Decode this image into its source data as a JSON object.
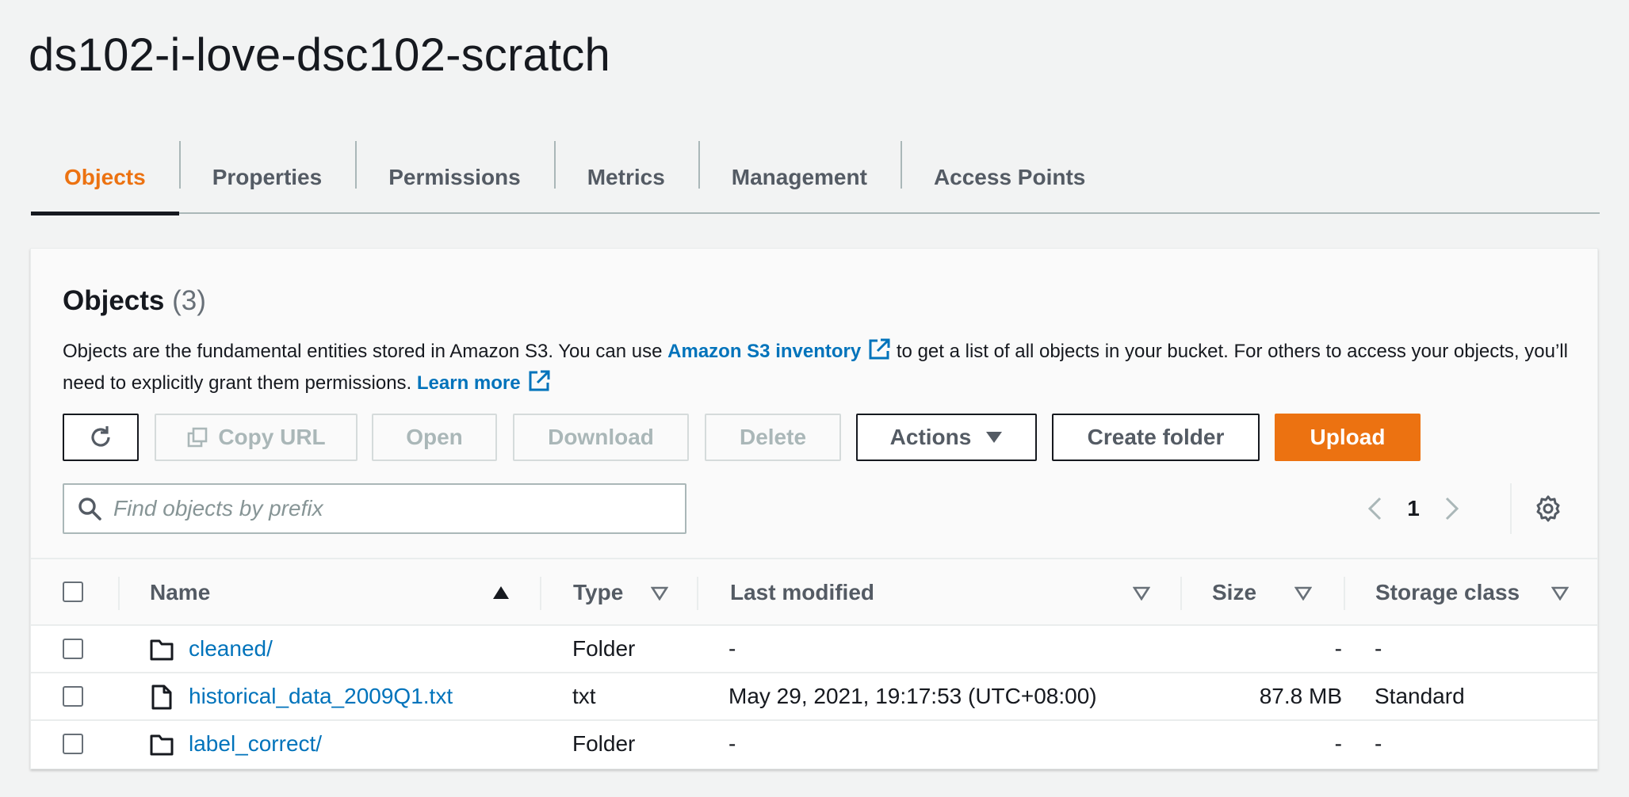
{
  "page": {
    "title": "ds102-i-love-dsc102-scratch"
  },
  "tabs": [
    {
      "label": "Objects",
      "active": true
    },
    {
      "label": "Properties",
      "active": false
    },
    {
      "label": "Permissions",
      "active": false
    },
    {
      "label": "Metrics",
      "active": false
    },
    {
      "label": "Management",
      "active": false
    },
    {
      "label": "Access Points",
      "active": false
    }
  ],
  "objects_panel": {
    "title": "Objects",
    "count": "(3)",
    "desc_part1": "Objects are the fundamental entities stored in Amazon S3. You can use ",
    "inventory_link": "Amazon S3 inventory",
    "desc_part2": " to get a list of all objects in your bucket. For others to access your objects, you’ll need to explicitly grant them permissions. ",
    "learn_more": "Learn more"
  },
  "toolbar": {
    "refresh_icon": "refresh-icon",
    "copy_url": "Copy URL",
    "open": "Open",
    "download": "Download",
    "delete": "Delete",
    "actions": "Actions",
    "create_folder": "Create folder",
    "upload": "Upload"
  },
  "search": {
    "placeholder": "Find objects by prefix",
    "value": ""
  },
  "pagination": {
    "current_page": "1"
  },
  "colors": {
    "accent": "#ec7211",
    "link": "#0073bb",
    "text": "#16191f"
  },
  "table": {
    "columns": {
      "name": "Name",
      "type": "Type",
      "last_modified": "Last modified",
      "size": "Size",
      "storage_class": "Storage class"
    },
    "rows": [
      {
        "icon": "folder-icon",
        "name": "cleaned/",
        "type": "Folder",
        "last_modified": "-",
        "size": "-",
        "storage_class": "-"
      },
      {
        "icon": "file-icon",
        "name": "historical_data_2009Q1.txt",
        "type": "txt",
        "last_modified": "May 29, 2021, 19:17:53 (UTC+08:00)",
        "size": "87.8 MB",
        "storage_class": "Standard"
      },
      {
        "icon": "folder-icon",
        "name": "label_correct/",
        "type": "Folder",
        "last_modified": "-",
        "size": "-",
        "storage_class": "-"
      }
    ]
  }
}
